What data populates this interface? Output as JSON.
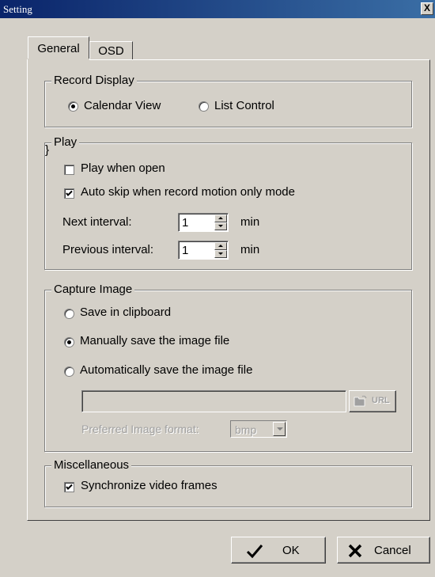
{
  "window": {
    "title": "Setting",
    "close_label": "X"
  },
  "tabs": [
    {
      "label": "General",
      "active": true
    },
    {
      "label": "OSD",
      "active": false
    }
  ],
  "record_display": {
    "legend": "Record Display",
    "options": [
      {
        "label": "Calendar View",
        "selected": true
      },
      {
        "label": "List Control",
        "selected": false
      }
    ]
  },
  "play": {
    "legend": "Play",
    "play_when_open": {
      "label": "Play when open",
      "checked": false
    },
    "auto_skip": {
      "label": "Auto skip when record motion only mode",
      "checked": true
    },
    "next_interval": {
      "label": "Next interval:",
      "value": "1",
      "unit": "min"
    },
    "previous_interval": {
      "label": "Previous interval:",
      "value": "1",
      "unit": "min"
    }
  },
  "capture_image": {
    "legend": "Capture Image",
    "options": [
      {
        "label": "Save in clipboard",
        "selected": false
      },
      {
        "label": "Manually save the image file",
        "selected": true
      },
      {
        "label": "Automatically save the image file",
        "selected": false
      }
    ],
    "path_value": "",
    "url_button_label": "URL",
    "format_label": "Preferred Image format:",
    "format_value": "bmp"
  },
  "misc": {
    "legend": "Miscellaneous",
    "sync_frames": {
      "label": "Synchronize video frames",
      "checked": true
    }
  },
  "buttons": {
    "ok": "OK",
    "cancel": "Cancel"
  },
  "icons": {
    "ok": "checkmark-icon",
    "cancel": "x-mark-icon",
    "folder": "folder-open-icon"
  }
}
